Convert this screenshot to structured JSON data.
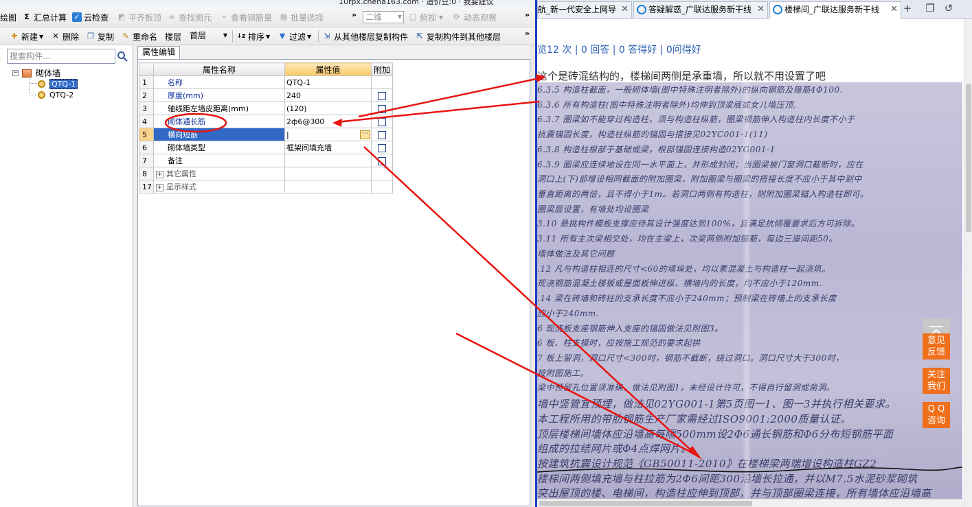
{
  "app": {
    "title_strip_text": "10rpx.chena163.com · 造价豆:0 · 我要建议",
    "toolbar1": {
      "draw": "绘图",
      "sum_calc": "汇总计算",
      "cloud_check": "云检查",
      "flat_slab": "平齐板顶",
      "find_element": "查找图元",
      "view_rebar": "查看钢筋量",
      "batch_select": "批量选择",
      "view_mode": "二维",
      "top_view": "俯视",
      "dynamic_view": "动态观察"
    },
    "toolbar2": {
      "new": "新建",
      "delete": "删除",
      "copy": "复制",
      "rename": "重命名",
      "floor_label": "楼层",
      "floor_value": "首层",
      "sort": "排序",
      "filter": "过滤",
      "copy_from_floor": "从其他楼层复制构件",
      "copy_to_floor": "复制构件到其他楼层"
    },
    "search_placeholder": "搜索构件...",
    "tree": {
      "root": "砌体墙",
      "children": [
        "QTQ-1",
        "QTQ-2"
      ]
    },
    "prop_tab": "属性编辑",
    "prop_table": {
      "headers": [
        "属性名称",
        "属性值",
        "附加"
      ],
      "rows": [
        {
          "num": "1",
          "name": "名称",
          "value": "QTQ-1"
        },
        {
          "num": "2",
          "name": "厚度(mm)",
          "value": "240"
        },
        {
          "num": "3",
          "name": "轴线距左墙皮距离(mm)",
          "value": "(120)"
        },
        {
          "num": "4",
          "name": "砌体通长筋",
          "value": "2ф6@300"
        },
        {
          "num": "5",
          "name": "横向短筋",
          "value": "|"
        },
        {
          "num": "6",
          "name": "砌体墙类型",
          "value": "框架间填充墙"
        },
        {
          "num": "7",
          "name": "备注",
          "value": ""
        },
        {
          "num": "8",
          "name": "其它属性",
          "value": ""
        },
        {
          "num": "17",
          "name": "显示样式",
          "value": ""
        }
      ]
    }
  },
  "browser": {
    "tabs": [
      {
        "label": "航_新一代安全上网导"
      },
      {
        "label": "答疑解惑_广联达服务新干线"
      },
      {
        "label": "楼梯间_广联达服务新干线"
      }
    ],
    "stats": "览12 次 | 0 回答 | 0 答得好 | 0问得好",
    "answer": "这个是砖混结构的，楼梯间两侧是承重墙，所以就不用设置了吧",
    "doc_lines": [
      "6.3.5  构造柱截面，一般砌体墙(图中特殊注明者除外)的纵向钢筋及箍筋4Φ100.",
      "6.3.6  所有构造柱(图中特殊注明者除外)均伸到顶梁底或女儿墙压顶,",
      "6.3.7  圈梁如不能穿过构造柱，须与构造柱纵筋，圈梁钢筋伸入构造柱内长度不小于",
      "抗震锚固长度，构造柱纵筋的锚固与搭接见02YC001-1(11)",
      "6.3.8  构造柱根部于基础或梁，根部锚固连接构造02YG001-1",
      "6.3.9  圈梁应连续地设在同一水平面上，并形成封闭；当圈梁被门窗洞口截断时，应在",
      "洞口上(下)部增设相同截面的附加圈梁，附加圈梁与圈梁的搭接长度不应小于其中到中",
      "垂直距离的两倍，且不得小于1m。若洞口两侧有构造柱，则附加圈梁锚入构造柱即可。",
      "圈梁层设置，有墙处均设圈梁",
      "3.10  悬挑构件模板支撑应待其设计强度达到100%，且满足抗倾覆要求后方可拆除。",
      "3.11  所有主次梁相交处，均在主梁上，次梁两侧附加箍筋，每边三道间距50。",
      "墙体做法及其它问题",
      ".12  凡与构造柱相连的尺寸<60的墙垛处，均以素混凝土与构造柱一起浇筑。",
      "   现浇钢筋混凝土楼板或屋面板伸进纵、横墙内的长度，均不应小于120mm.",
      ".14  梁在砖墙和砖柱的支承长度不应小于240mm；预制梁在砖墙上的支承长度",
      "应小于240mm.",
      "6  现浇板支座钢筋伸入支座的锚固做法见附图3。",
      "6  板、柱支模时，应按施工规范的要求起拱",
      "7  板上留洞，洞口尺寸<300时，钢筋不截断，绕过洞口。洞口尺寸大于300时，",
      "   按附图施工。",
      "   梁中预留孔位置须准确，做法见附图1，未经设计许可，不得自行留洞或凿洞。",
      "墙中竖管宜预埋，做法见02YG001-1第5页图一1、图一3并执行相关要求。",
      "   本工程所用的带肋钢筋生产厂家需经过ISO9001:2000质量认证。",
      "   顶层楼梯间墙体应沿墙高每隔500mm设2Φ6通长钢筋和Φ6分布短钢筋平面",
      "组成的拉结网片或Φ4点焊网片。",
      "按建筑抗震设计规范《GB50011-2010》在楼梯梁两端增设构造柱GZ2",
      "楼梯间两侧填充墙与柱拉筋为2Φ6间距300沿墙长拉通，并以M7.5水泥砂浆砌筑",
      "突出屋顶的楼、电梯间，构造柱应伸到顶部，并与顶部圈梁连接，所有墙体应沿墙高"
    ],
    "float_buttons": {
      "feedback": [
        "意见",
        "反馈"
      ],
      "follow": [
        "关注",
        "我们"
      ],
      "qq": [
        "Q Q",
        "咨询"
      ]
    }
  },
  "colors": {
    "annotation_red": "#e8140f",
    "selection_blue": "#3169c6",
    "float_orange": "#f06f1a",
    "browser_border": "#1a3cc2"
  }
}
